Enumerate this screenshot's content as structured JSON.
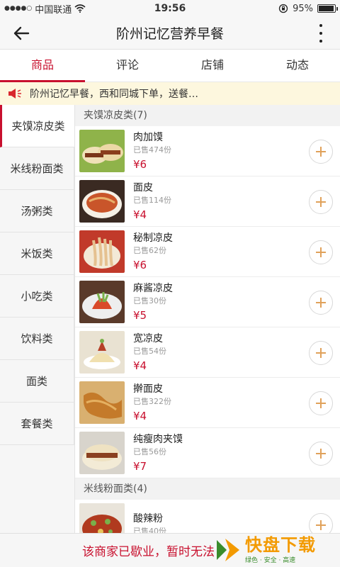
{
  "status_bar": {
    "carrier": "中国联通",
    "time": "19:56",
    "battery_text": "95%",
    "battery_level": 0.95
  },
  "nav": {
    "title": "阶州记忆营养早餐",
    "icons": [
      "back-arrow-icon",
      "more-vertical-icon"
    ]
  },
  "tabs": [
    {
      "label": "商品",
      "active": true
    },
    {
      "label": "评论"
    },
    {
      "label": "店铺"
    },
    {
      "label": "动态"
    }
  ],
  "notice": {
    "text": "阶州记忆早餐，西和同城下单，送餐…",
    "icon": "speaker-icon"
  },
  "sidebar": {
    "items": [
      {
        "label": "夹馍凉皮类",
        "active": true
      },
      {
        "label": "米线粉面类"
      },
      {
        "label": "汤粥类"
      },
      {
        "label": "米饭类"
      },
      {
        "label": "小吃类"
      },
      {
        "label": "饮料类"
      },
      {
        "label": "面类"
      },
      {
        "label": "套餐类"
      }
    ]
  },
  "categories": [
    {
      "header": "夹馍凉皮类(7)",
      "items": [
        {
          "name": "肉加馍",
          "sold": "已售474份",
          "price": "¥6"
        },
        {
          "name": "面皮",
          "sold": "已售114份",
          "price": "¥4"
        },
        {
          "name": "秘制凉皮",
          "sold": "已售62份",
          "price": "¥6"
        },
        {
          "name": "麻酱凉皮",
          "sold": "已售30份",
          "price": "¥5"
        },
        {
          "name": "宽凉皮",
          "sold": "已售54份",
          "price": "¥4"
        },
        {
          "name": "擀面皮",
          "sold": "已售322份",
          "price": "¥4"
        },
        {
          "name": "纯瘦肉夹馍",
          "sold": "已售56份",
          "price": "¥7"
        }
      ]
    },
    {
      "header": "米线粉面类(4)",
      "items": [
        {
          "name": "酸辣粉",
          "sold": "已售40份",
          "price": ""
        }
      ]
    }
  ],
  "bottom": {
    "text": "该商家已歇业，暂时无法",
    "watermark": "快盘下载",
    "watermark_sub": "绿色 · 安全 · 高速"
  },
  "colors": {
    "accent": "#c8102e",
    "notice_bg": "#fdf7de",
    "watermark": "#f39a00"
  }
}
